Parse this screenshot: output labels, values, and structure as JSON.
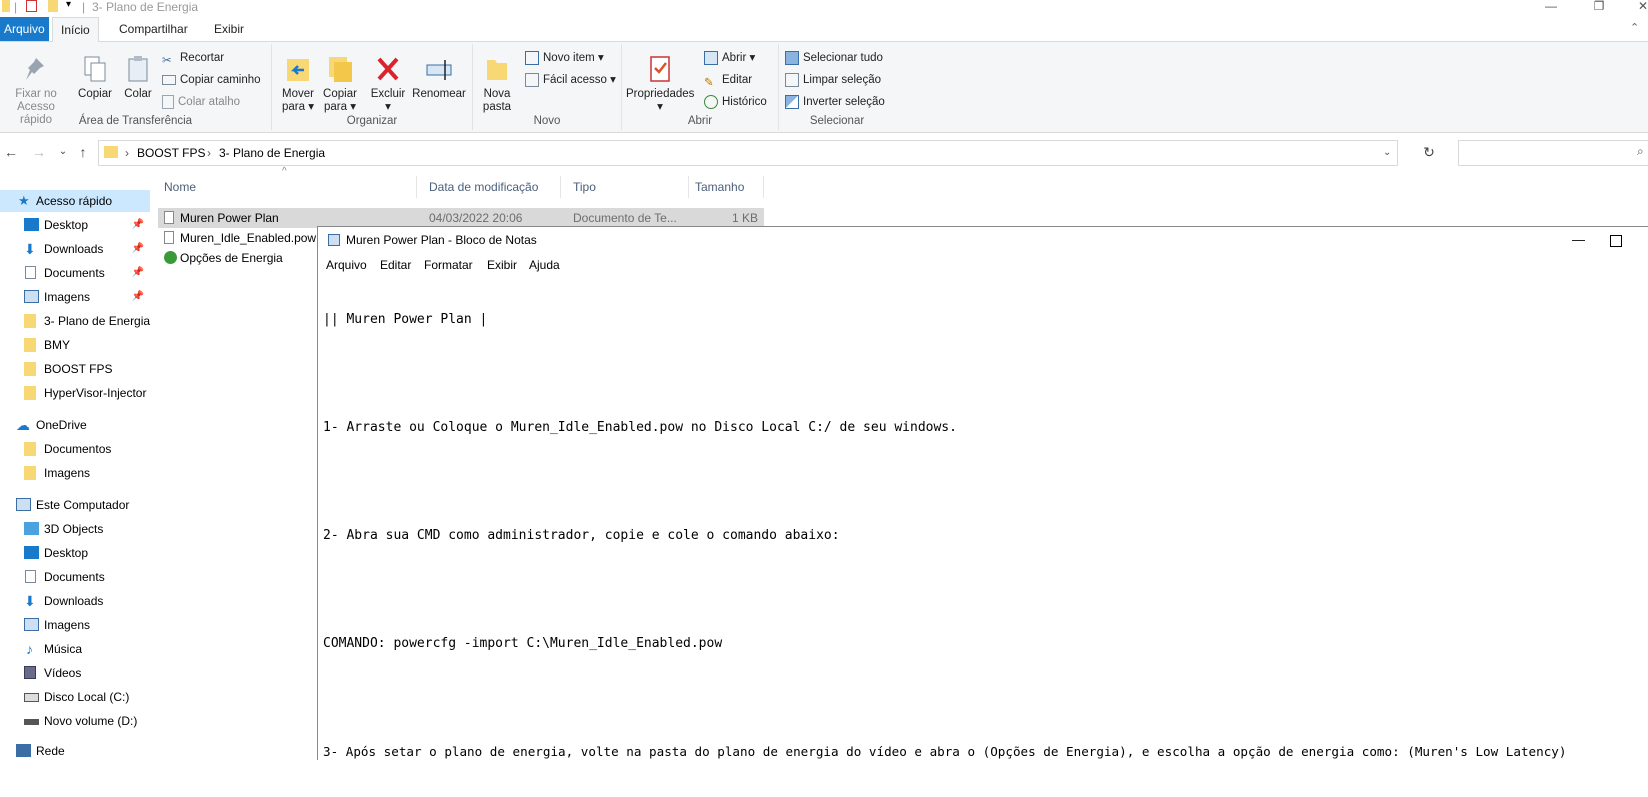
{
  "explorer": {
    "title": "3- Plano de Energia",
    "tabs": [
      "Arquivo",
      "Início",
      "Compartilhar",
      "Exibir"
    ],
    "ribbon": {
      "clipboard": {
        "group_label": "Área de Transferência",
        "pin": "Fixar no\nAcesso rápido",
        "pin_l1": "Fixar no",
        "pin_l2": "Acesso rápido",
        "copy": "Copiar",
        "paste": "Colar",
        "cut": "Recortar",
        "copy_path": "Copiar caminho",
        "paste_shortcut": "Colar atalho"
      },
      "organize": {
        "group_label": "Organizar",
        "move_l1": "Mover",
        "move_l2": "para",
        "copy_l1": "Copiar",
        "copy_l2": "para",
        "delete": "Excluir",
        "rename": "Renomear"
      },
      "new": {
        "group_label": "Novo",
        "new_folder_l1": "Nova",
        "new_folder_l2": "pasta",
        "new_item": "Novo item",
        "easy_access": "Fácil acesso"
      },
      "open": {
        "group_label": "Abrir",
        "properties": "Propriedades",
        "open": "Abrir",
        "edit": "Editar",
        "history": "Histórico"
      },
      "select": {
        "group_label": "Selecionar",
        "select_all": "Selecionar tudo",
        "select_none": "Limpar seleção",
        "invert": "Inverter seleção"
      }
    },
    "breadcrumb": [
      "BOOST FPS",
      "3- Plano de Energia"
    ],
    "nav": {
      "quick_access": "Acesso rápido",
      "quick_items": [
        "Desktop",
        "Downloads",
        "Documents",
        "Imagens",
        "3- Plano de Energia",
        "BMY",
        "BOOST FPS",
        "HyperVisor-Injector"
      ],
      "onedrive": "OneDrive",
      "onedrive_items": [
        "Documentos",
        "Imagens"
      ],
      "this_pc": "Este Computador",
      "pc_items": [
        "3D Objects",
        "Desktop",
        "Documents",
        "Downloads",
        "Imagens",
        "Música",
        "Vídeos",
        "Disco Local (C:)",
        "Novo volume (D:)"
      ],
      "network": "Rede"
    },
    "columns": [
      "Nome",
      "Data de modificação",
      "Tipo",
      "Tamanho"
    ],
    "files": [
      {
        "name": "Muren Power Plan",
        "date": "04/03/2022 20:06",
        "type": "Documento de Te...",
        "size": "1 KB"
      },
      {
        "name": "Muren_Idle_Enabled.pow",
        "date": "",
        "type": "",
        "size": ""
      },
      {
        "name": "Opções de Energia",
        "date": "",
        "type": "",
        "size": ""
      }
    ]
  },
  "notepad": {
    "title": "Muren Power Plan - Bloco de Notas",
    "menu": [
      "Arquivo",
      "Editar",
      "Formatar",
      "Exibir",
      "Ajuda"
    ],
    "lines": [
      "|| Muren Power Plan |",
      "",
      "1- Arraste ou Coloque o Muren_Idle_Enabled.pow no Disco Local C:/ de seu windows.",
      "",
      "2- Abra sua CMD como administrador, copie e cole o comando abaixo:",
      "",
      "COMANDO: powercfg -import C:\\Muren_Idle_Enabled.pow",
      "",
      "3- Após setar o plano de energia, volte na pasta do plano de energia do vídeo e abra o (Opções de Energia), e escolha a opção de energia como: (Muren's Low Latency)"
    ]
  },
  "colors": {
    "accent": "#1979ca",
    "selection": "#cce8ff",
    "folder": "#f8d775"
  }
}
